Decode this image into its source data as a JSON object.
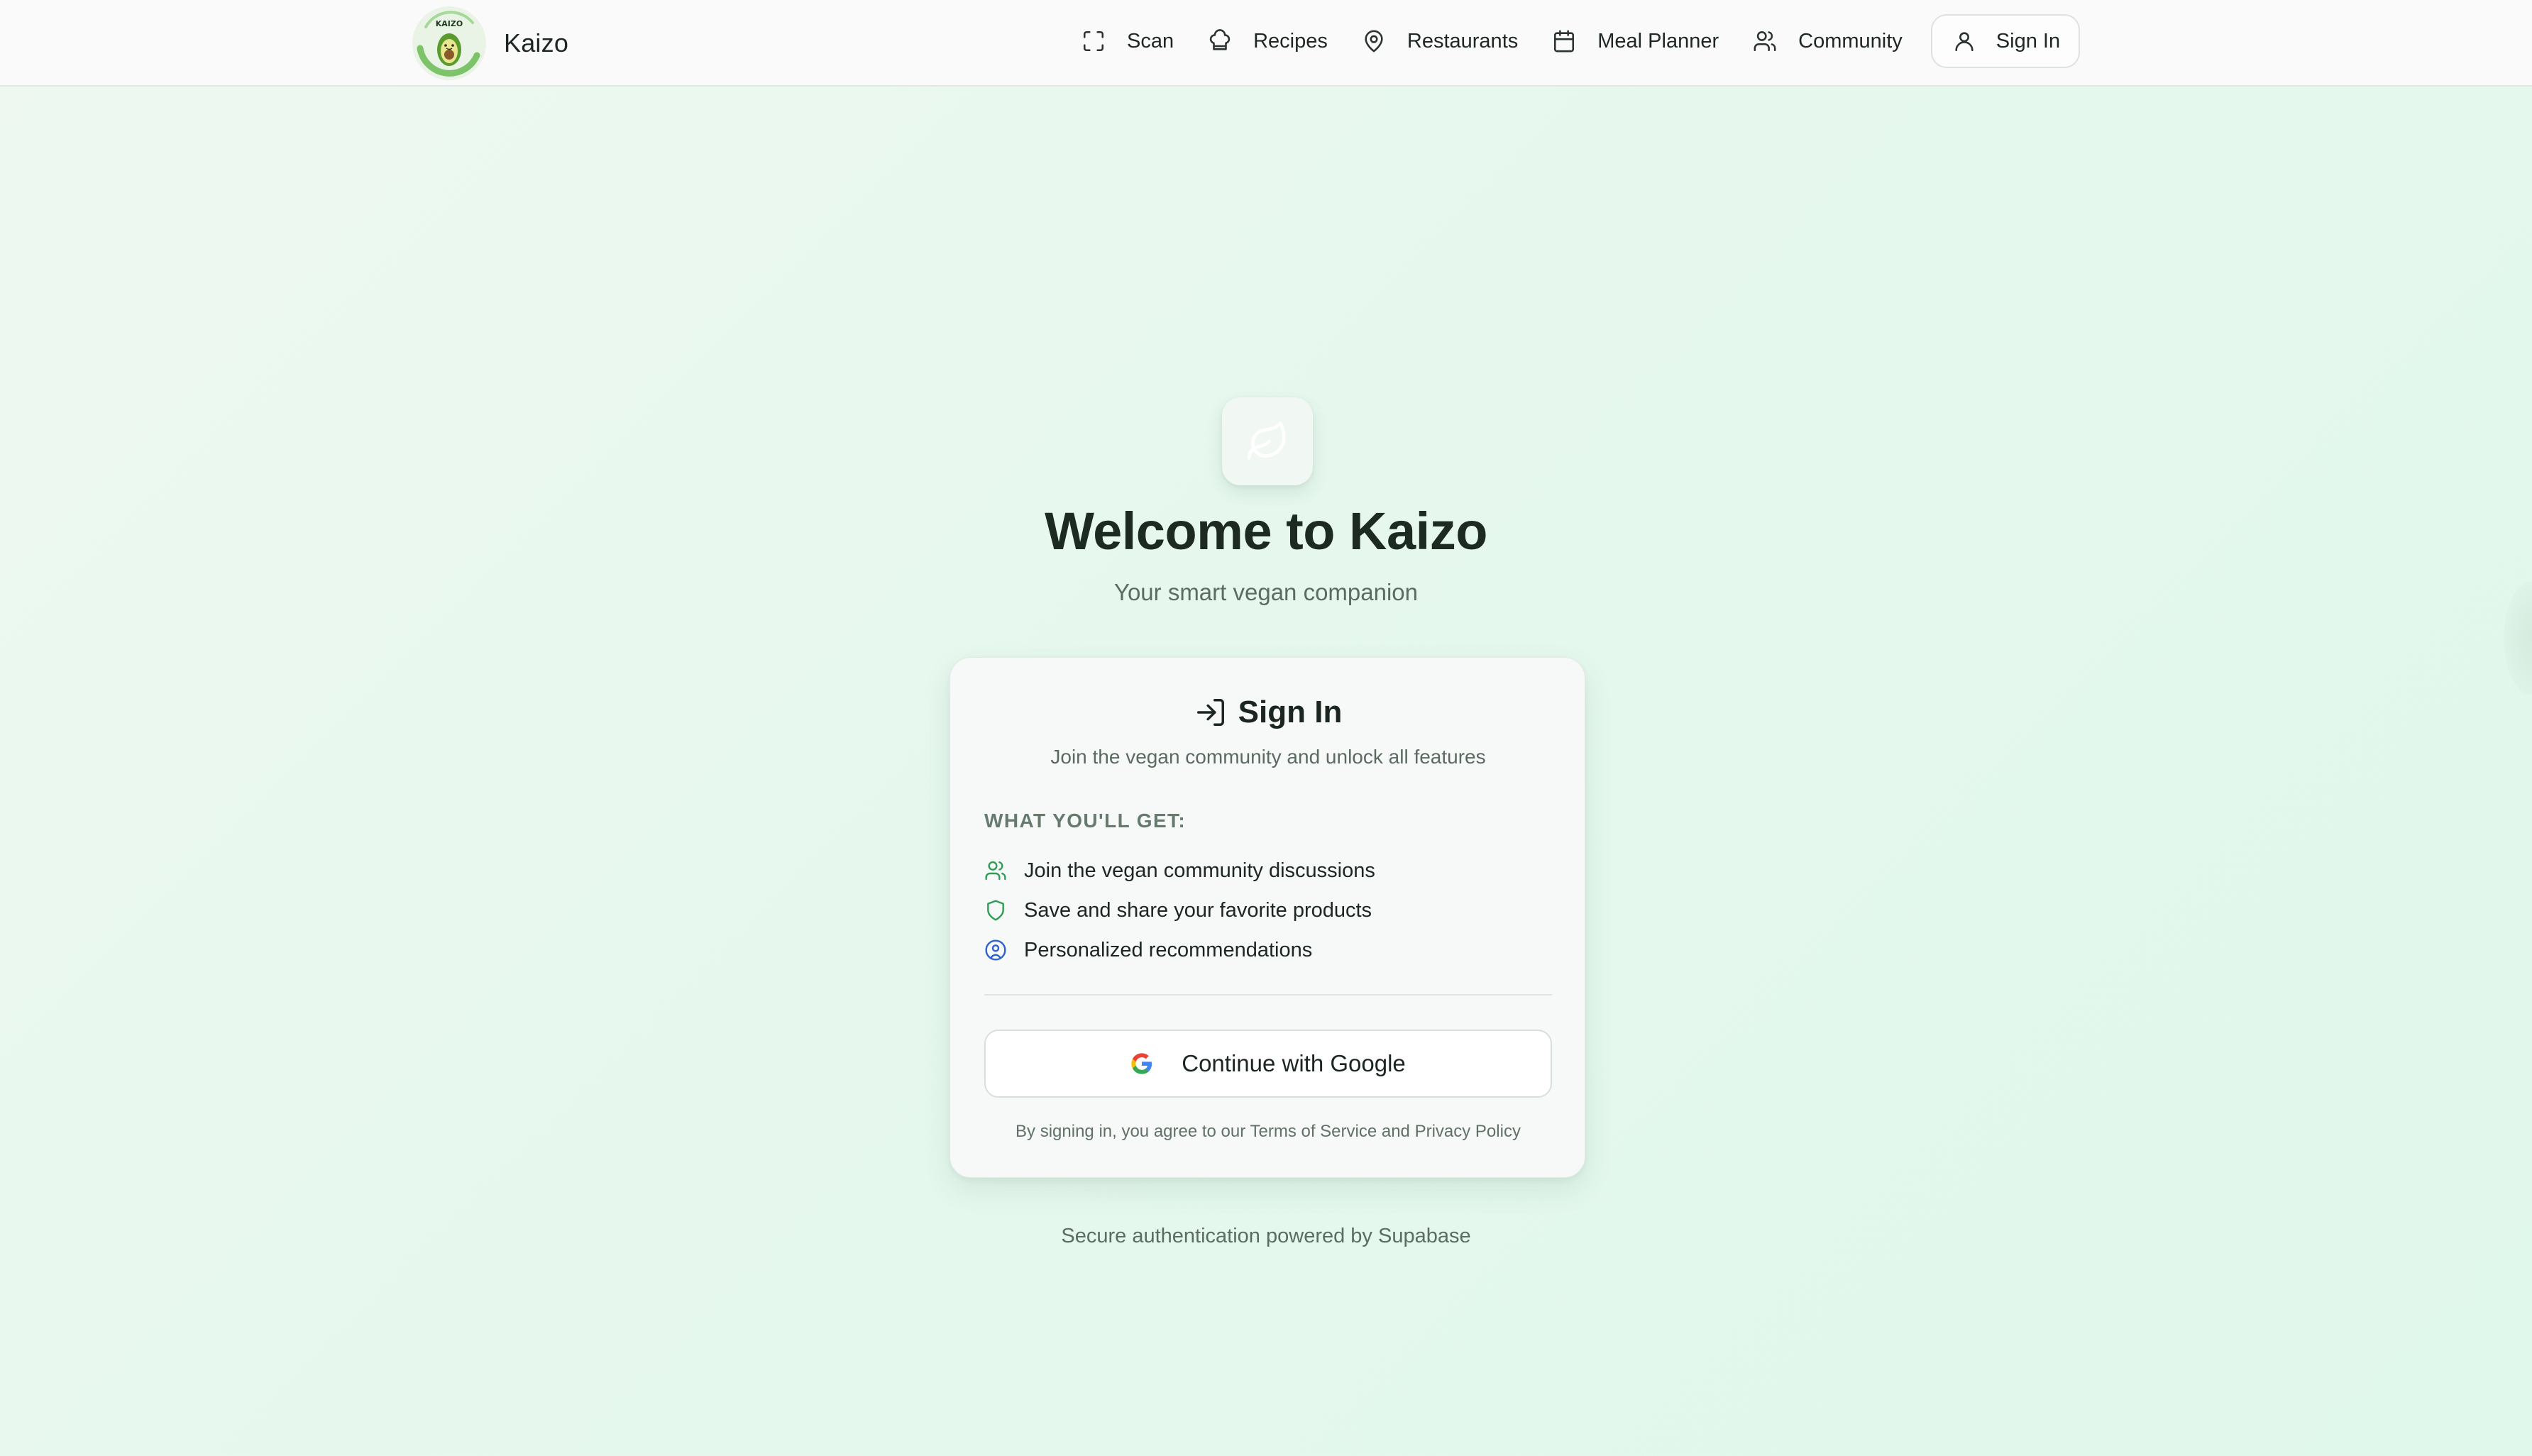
{
  "header": {
    "brand_name": "Kaizo",
    "logo_text": "KAIZO",
    "nav": [
      {
        "label": "Scan",
        "icon": "scan-icon"
      },
      {
        "label": "Recipes",
        "icon": "chef-hat-icon"
      },
      {
        "label": "Restaurants",
        "icon": "map-pin-icon"
      },
      {
        "label": "Meal Planner",
        "icon": "calendar-icon"
      },
      {
        "label": "Community",
        "icon": "users-icon"
      }
    ],
    "sign_in": {
      "label": "Sign In",
      "icon": "user-icon"
    }
  },
  "hero": {
    "icon": "leaf-icon",
    "title": "Welcome to Kaizo",
    "subtitle": "Your smart vegan companion"
  },
  "card": {
    "title": "Sign In",
    "title_icon": "log-in-icon",
    "subtitle": "Join the vegan community and unlock all features",
    "features_heading": "WHAT YOU'LL GET:",
    "features": [
      {
        "label": "Join the vegan community discussions",
        "icon": "users-icon",
        "color": "#2e9d55"
      },
      {
        "label": "Save and share your favorite products",
        "icon": "shield-icon",
        "color": "#2e9d55"
      },
      {
        "label": "Personalized recommendations",
        "icon": "user-circle-icon",
        "color": "#2f5fd0"
      }
    ],
    "google_button": "Continue with Google",
    "legal_text": "By signing in, you agree to our Terms of Service and Privacy Policy"
  },
  "footer": {
    "note": "Secure authentication powered by Supabase"
  },
  "colors": {
    "background": "#e6f8ee",
    "accent_green": "#2e9d55",
    "accent_blue": "#2f5fd0"
  }
}
